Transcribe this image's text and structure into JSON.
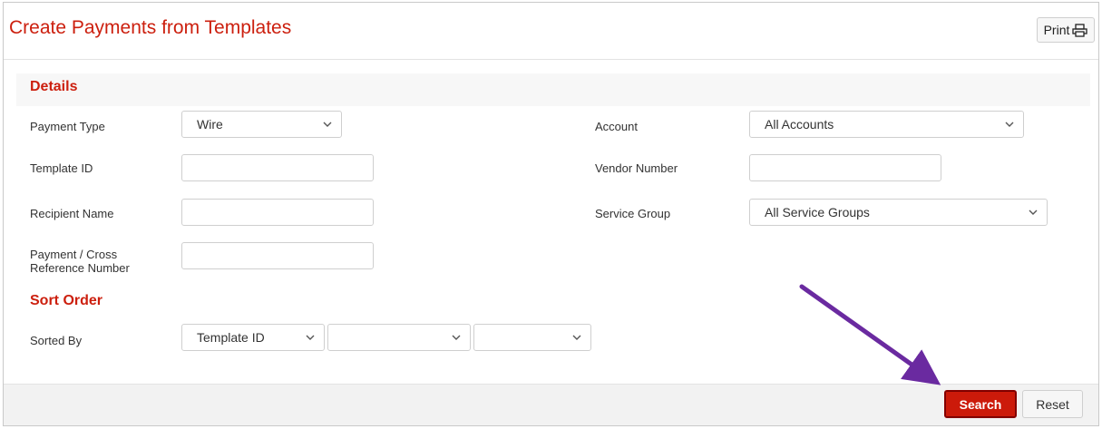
{
  "header": {
    "title": "Create Payments from Templates",
    "print_label": "Print"
  },
  "details": {
    "section_title": "Details",
    "payment_type": {
      "label": "Payment Type",
      "value": "Wire"
    },
    "account": {
      "label": "Account",
      "value": "All Accounts"
    },
    "template_id": {
      "label": "Template ID",
      "value": ""
    },
    "vendor_number": {
      "label": "Vendor Number",
      "value": ""
    },
    "recipient_name": {
      "label": "Recipient Name",
      "value": ""
    },
    "service_group": {
      "label": "Service Group",
      "value": "All Service Groups"
    },
    "payment_reference": {
      "label_line1": "Payment / Cross",
      "label_line2": "Reference Number",
      "value": ""
    }
  },
  "sort_order": {
    "section_title": "Sort Order",
    "sorted_by": {
      "label": "Sorted By",
      "value1": "Template ID",
      "value2": "",
      "value3": ""
    }
  },
  "actions": {
    "search_label": "Search",
    "reset_label": "Reset"
  },
  "colors": {
    "brand_red": "#cc1f0e",
    "annotation_arrow": "#6a2aa0"
  },
  "icons": [
    "printer-icon",
    "chevron-down-icon"
  ]
}
